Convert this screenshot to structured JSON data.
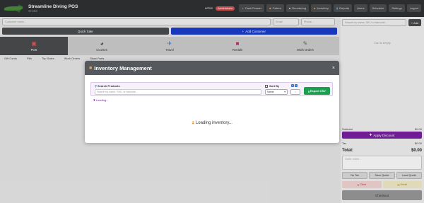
{
  "header": {
    "app_title": "Streamline Diving POS",
    "app_subtitle": "STORE",
    "user": "admin",
    "role": "Administrator",
    "nav": [
      {
        "label": "Cash Drawer",
        "icon": "cash-icon"
      },
      {
        "label": "Orders",
        "icon": "orders-icon"
      },
      {
        "label": "Reordering",
        "icon": "reorder-icon"
      },
      {
        "label": "Inventory",
        "icon": "inventory-icon"
      },
      {
        "label": "Reports",
        "icon": "reports-icon"
      },
      {
        "label": "Users",
        "icon": "users-icon"
      },
      {
        "label": "Schedule",
        "icon": "schedule-icon"
      },
      {
        "label": "Settings",
        "icon": "settings-icon"
      },
      {
        "label": "Logout",
        "icon": "logout-icon"
      }
    ]
  },
  "customer": {
    "name_placeholder": "Customer name...",
    "email_placeholder": "Email",
    "phone_placeholder": "Phone..."
  },
  "actions": {
    "quick_sale": "Quick Sale",
    "add_customer": "Add Customer"
  },
  "categories": [
    {
      "label": "POS",
      "icon": "pos-icon",
      "active": true
    },
    {
      "label": "Courses",
      "icon": "courses-icon",
      "active": false
    },
    {
      "label": "Travel",
      "icon": "travel-icon",
      "active": false
    },
    {
      "label": "Rentals",
      "icon": "rentals-icon",
      "active": false
    },
    {
      "label": "Work Orders",
      "icon": "work-orders-icon",
      "active": false
    }
  ],
  "subcategories": [
    "Gift Cards",
    "Fills",
    "Top Sales",
    "Work Orders",
    "Store Parts"
  ],
  "cart": {
    "search_placeholder": "Search by name, SKU or barcode...",
    "add_label": "Add",
    "empty_text": "Cart is empty",
    "subtotal_label": "Subtotal",
    "subtotal_value": "$0.00",
    "apply_discount": "Apply Discount",
    "tax_label": "Tax",
    "tax_value": "$0.00",
    "total_label": "Total:",
    "total_value": "$0.00",
    "notes_placeholder": "Order notes...",
    "tax_exempt": "No Tax",
    "save_quote": "Save Quote",
    "load_quote": "Load Quote",
    "clear": "Clear",
    "email": "Email",
    "checkout": "Checkout"
  },
  "modal": {
    "title": "Inventory Management",
    "close": "×",
    "search_label": "Search Products",
    "search_placeholder": "Search by name, SKU, or barcode...",
    "sort_label": "Sort By",
    "sort_value": "Name",
    "direction_value": "↑",
    "export_label": "Export CSV",
    "loading_small": "Loading...",
    "loading_big": "Loading inventory..."
  },
  "colors": {
    "topbar": "#2f3133",
    "primary_blue": "#1a3ccc",
    "discount_purple": "#7a1fa2",
    "export_green": "#1e9e4f",
    "modal_header": "#55585c"
  }
}
